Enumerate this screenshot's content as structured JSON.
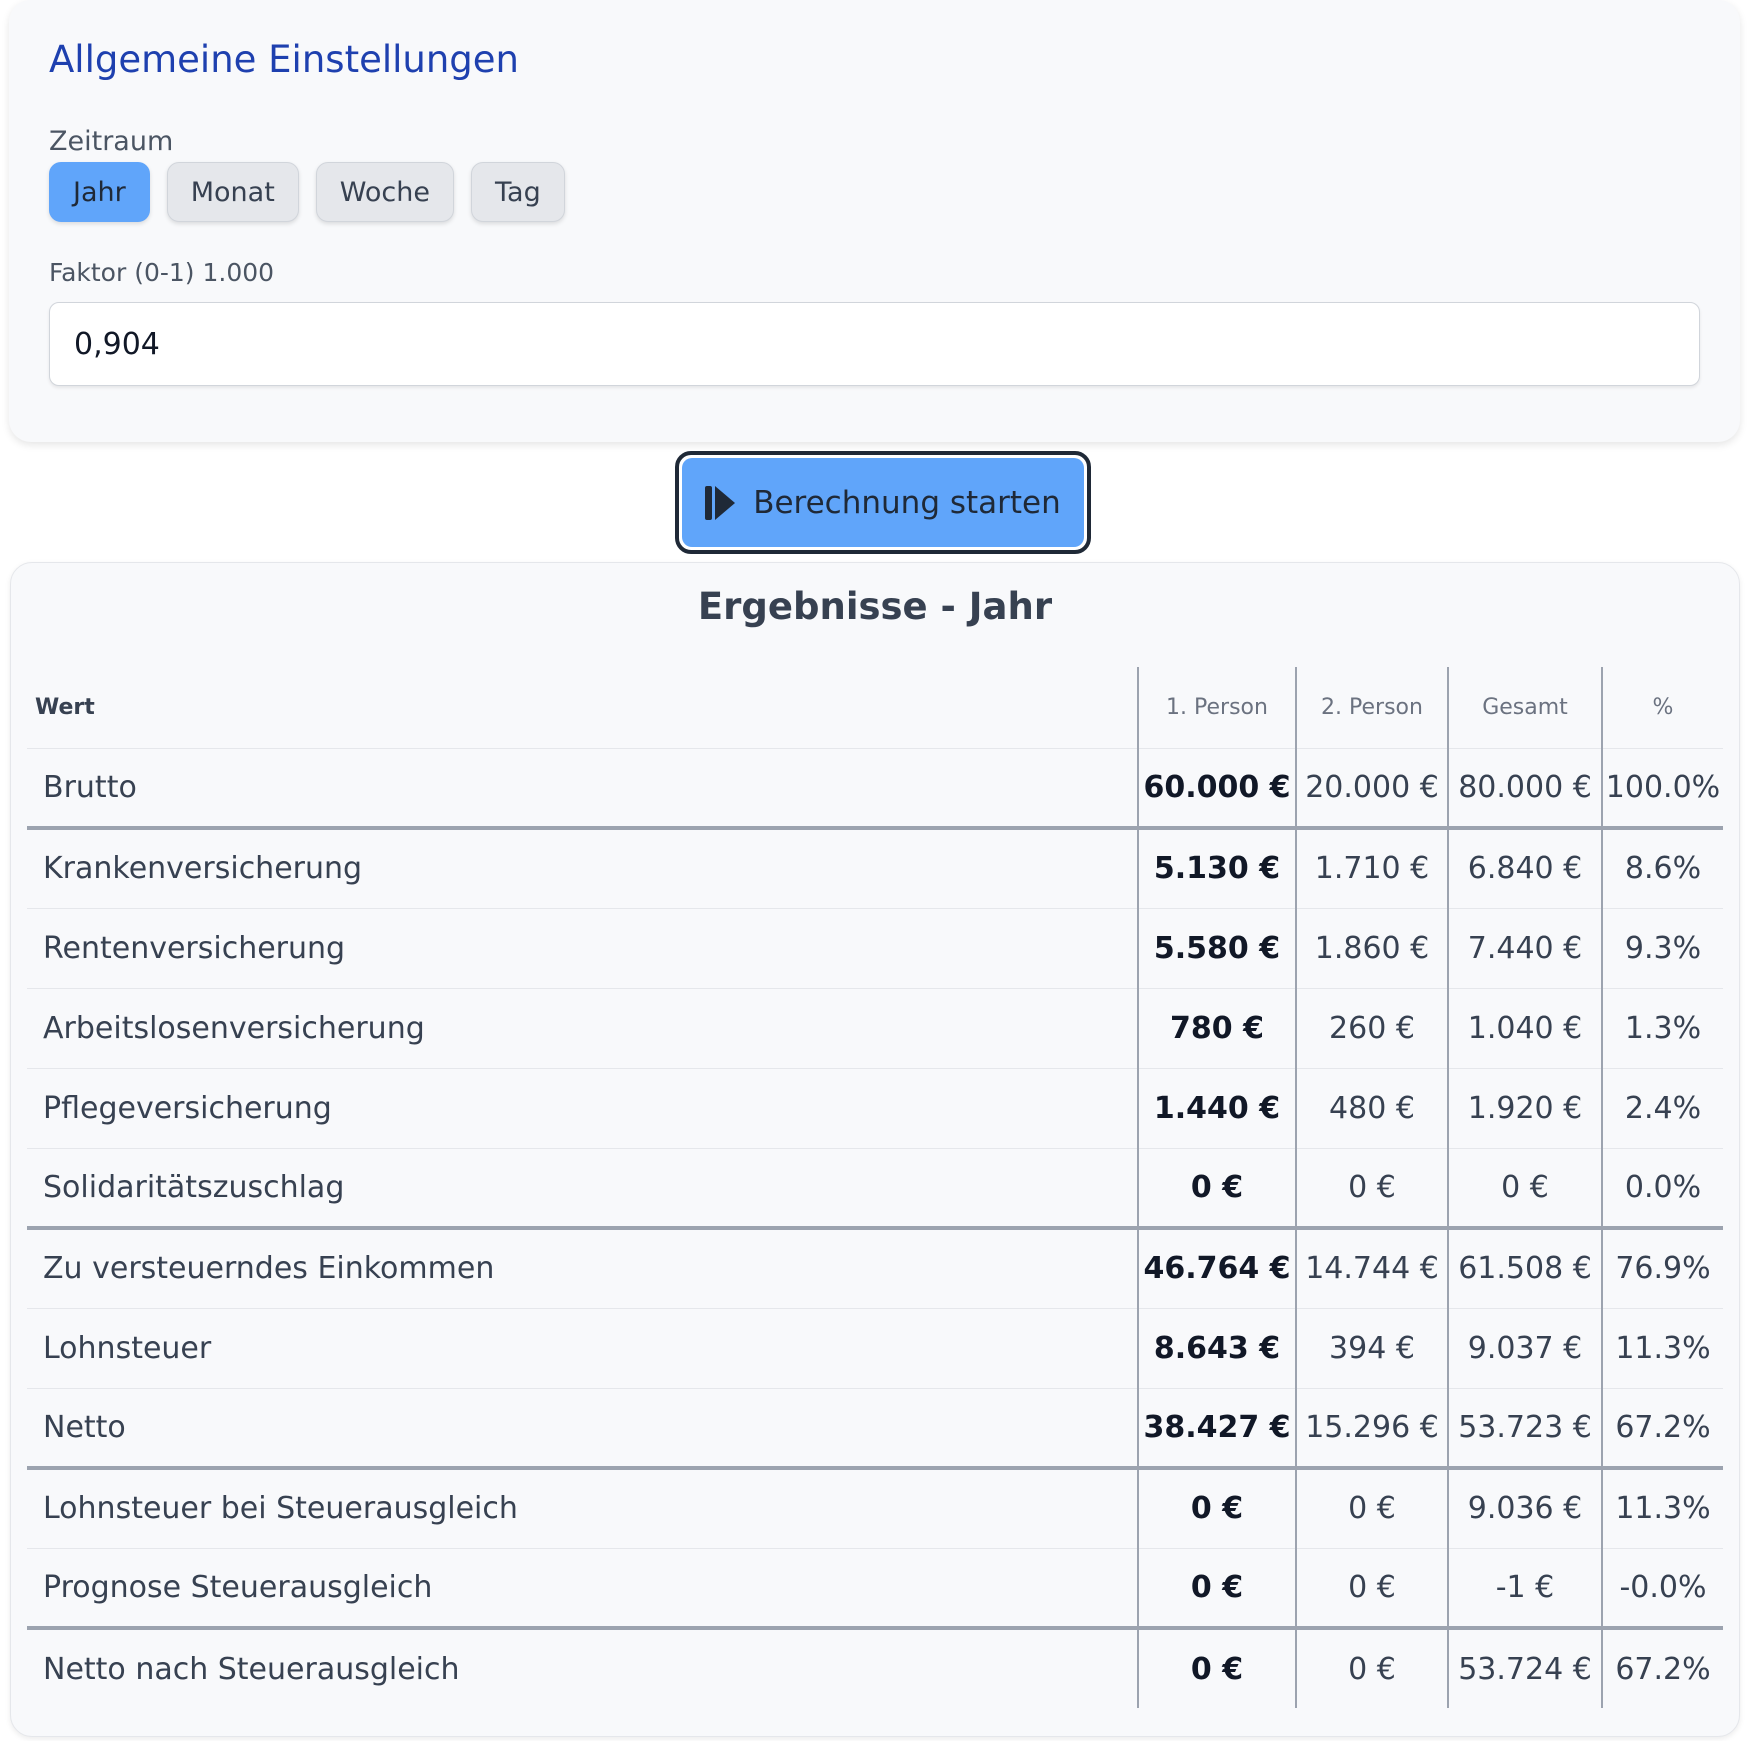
{
  "settings": {
    "title": "Allgemeine Einstellungen",
    "period_label": "Zeitraum",
    "periods": [
      "Jahr",
      "Monat",
      "Woche",
      "Tag"
    ],
    "selected_period": "Jahr",
    "factor_label": "Faktor (0-1) 1.000",
    "factor_value": "0,904"
  },
  "start_button": {
    "label": "Berechnung starten",
    "icon": "play-icon"
  },
  "results": {
    "title": "Ergebnisse - Jahr",
    "columns": [
      "Wert",
      "1. Person",
      "2. Person",
      "Gesamt",
      "%"
    ],
    "rows": [
      {
        "label": "Brutto",
        "p1": "60.000 €",
        "p2": "20.000 €",
        "total": "80.000 €",
        "pct": "100.0%"
      },
      {
        "label": "Krankenversicherung",
        "p1": "5.130 €",
        "p2": "1.710 €",
        "total": "6.840 €",
        "pct": "8.6%"
      },
      {
        "label": "Rentenversicherung",
        "p1": "5.580 €",
        "p2": "1.860 €",
        "total": "7.440 €",
        "pct": "9.3%"
      },
      {
        "label": "Arbeitslosenversicherung",
        "p1": "780 €",
        "p2": "260 €",
        "total": "1.040 €",
        "pct": "1.3%"
      },
      {
        "label": "Pflegeversicherung",
        "p1": "1.440 €",
        "p2": "480 €",
        "total": "1.920 €",
        "pct": "2.4%"
      },
      {
        "label": "Solidaritätszuschlag",
        "p1": "0 €",
        "p2": "0 €",
        "total": "0 €",
        "pct": "0.0%"
      },
      {
        "label": "Zu versteuerndes Einkommen",
        "p1": "46.764 €",
        "p2": "14.744 €",
        "total": "61.508 €",
        "pct": "76.9%"
      },
      {
        "label": "Lohnsteuer",
        "p1": "8.643 €",
        "p2": "394 €",
        "total": "9.037 €",
        "pct": "11.3%"
      },
      {
        "label": "Netto",
        "p1": "38.427 €",
        "p2": "15.296 €",
        "total": "53.723 €",
        "pct": "67.2%"
      },
      {
        "label": "Lohnsteuer bei Steuerausgleich",
        "p1": "0 €",
        "p2": "0 €",
        "total": "9.036 €",
        "pct": "11.3%"
      },
      {
        "label": "Prognose Steuerausgleich",
        "p1": "0 €",
        "p2": "0 €",
        "total": "-1 €",
        "pct": "-0.0%"
      },
      {
        "label": "Netto nach Steuerausgleich",
        "p1": "0 €",
        "p2": "0 €",
        "total": "53.724 €",
        "pct": "67.2%"
      }
    ]
  },
  "colors": {
    "accent": "#60a5fa",
    "title_blue": "#1e40af",
    "card_bg": "#f8f9fb",
    "separator": "#9ca3af"
  }
}
